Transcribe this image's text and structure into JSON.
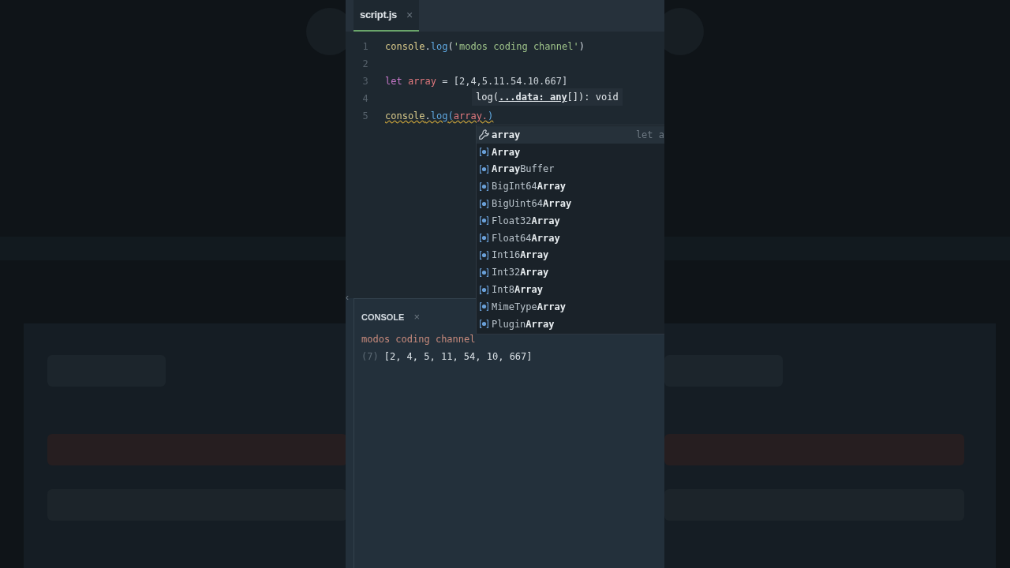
{
  "tab": {
    "label": "script.js",
    "close": "×",
    "selected": true
  },
  "code_lines": [
    {
      "number": "1",
      "squiggle": false,
      "tokens": [
        {
          "kind": "variable",
          "text": "console"
        },
        {
          "kind": "punct",
          "text": "."
        },
        {
          "kind": "method",
          "text": "log"
        },
        {
          "kind": "punct",
          "text": "("
        },
        {
          "kind": "string",
          "text": "'modos coding channel'"
        },
        {
          "kind": "punct",
          "text": ")"
        }
      ]
    },
    {
      "number": "2",
      "squiggle": false
    },
    {
      "number": "3",
      "squiggle": false,
      "tokens": [
        {
          "kind": "keyword",
          "text": "let "
        },
        {
          "kind": "param",
          "text": "array"
        },
        {
          "kind": "punct",
          "text": " = [2,4,5.11.54.10.667]"
        }
      ]
    },
    {
      "number": "4",
      "squiggle": false
    },
    {
      "number": "5",
      "squiggle": true,
      "tokens": [
        {
          "kind": "variable",
          "text": "console"
        },
        {
          "kind": "punct",
          "text": "."
        },
        {
          "kind": "method",
          "text": "log"
        },
        {
          "kind": "bracket",
          "text": "("
        },
        {
          "kind": "param",
          "text": "array."
        },
        {
          "kind": "bracket",
          "text": ")"
        }
      ]
    }
  ],
  "signature_hint": "log(**...data: any**[]): void",
  "suggestions": [
    {
      "kind": "variable",
      "label": "**array**",
      "detail": "let a",
      "selected": true
    },
    {
      "kind": "class",
      "label": "**Array**",
      "selected": false
    },
    {
      "kind": "class",
      "label": "**Array**Buffer",
      "selected": false
    },
    {
      "kind": "class",
      "label": "BigInt64**Array**",
      "selected": false
    },
    {
      "kind": "class",
      "label": "BigUint64**Array**",
      "selected": false
    },
    {
      "kind": "class",
      "label": "Float32**Array**",
      "selected": false
    },
    {
      "kind": "class",
      "label": "Float64**Array**",
      "selected": false
    },
    {
      "kind": "class",
      "label": "Int16**Array**",
      "selected": false
    },
    {
      "kind": "class",
      "label": "Int32**Array**",
      "selected": false
    },
    {
      "kind": "class",
      "label": "Int8**Array**",
      "selected": false
    },
    {
      "kind": "class",
      "label": "MimeType**Array**",
      "selected": false
    },
    {
      "kind": "class",
      "label": "Plugin**Array**",
      "selected": false
    }
  ],
  "console": {
    "title": "CONSOLE",
    "close": "×",
    "collapse": "‹",
    "lines": [
      {
        "kind": "log",
        "text": "modos coding channel"
      },
      {
        "kind": "array",
        "count": "(7)",
        "text": "[2, 4, 5, 11, 54, 10, 667]"
      }
    ]
  }
}
